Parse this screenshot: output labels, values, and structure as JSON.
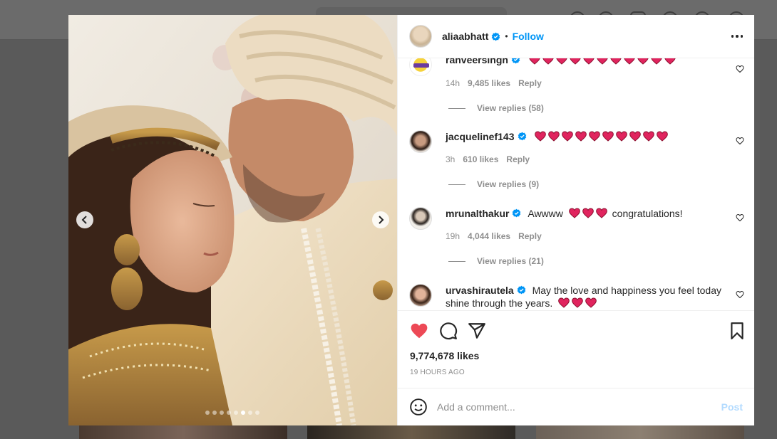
{
  "post": {
    "author": "aliaabhatt",
    "separator": "•",
    "follow_label": "Follow",
    "likes_label": "9,774,678 likes",
    "time_ago": "19 HOURS AGO",
    "carousel": {
      "total": 8,
      "active_index": 5
    }
  },
  "comments": [
    {
      "user": "ranveersingh",
      "text": "",
      "hearts": 11,
      "time": "14h",
      "likes": "9,485 likes",
      "reply": "Reply",
      "replies_label": "View replies (58)"
    },
    {
      "user": "jacquelinef143",
      "text": "",
      "hearts": 10,
      "time": "3h",
      "likes": "610 likes",
      "reply": "Reply",
      "replies_label": "View replies (9)"
    },
    {
      "user": "mrunalthakur",
      "text_before": "Awwww",
      "text_after": "congratulations!",
      "hearts": 3,
      "time": "19h",
      "likes": "4,044 likes",
      "reply": "Reply",
      "replies_label": "View replies (21)"
    },
    {
      "user": "urvashirautela",
      "text": "May the love and happiness you feel today shine through the years.",
      "hearts": 3
    }
  ],
  "comment_box": {
    "placeholder": "Add a comment...",
    "post_label": "Post"
  },
  "colors": {
    "accent": "#0095f6",
    "like_red": "#ed4956",
    "muted": "#8e8e8e"
  },
  "icons": [
    "verified-badge-icon",
    "more-options-icon",
    "heart-icon",
    "comment-icon",
    "share-icon",
    "bookmark-icon",
    "emoji-icon",
    "chevron-left-icon",
    "chevron-right-icon"
  ]
}
